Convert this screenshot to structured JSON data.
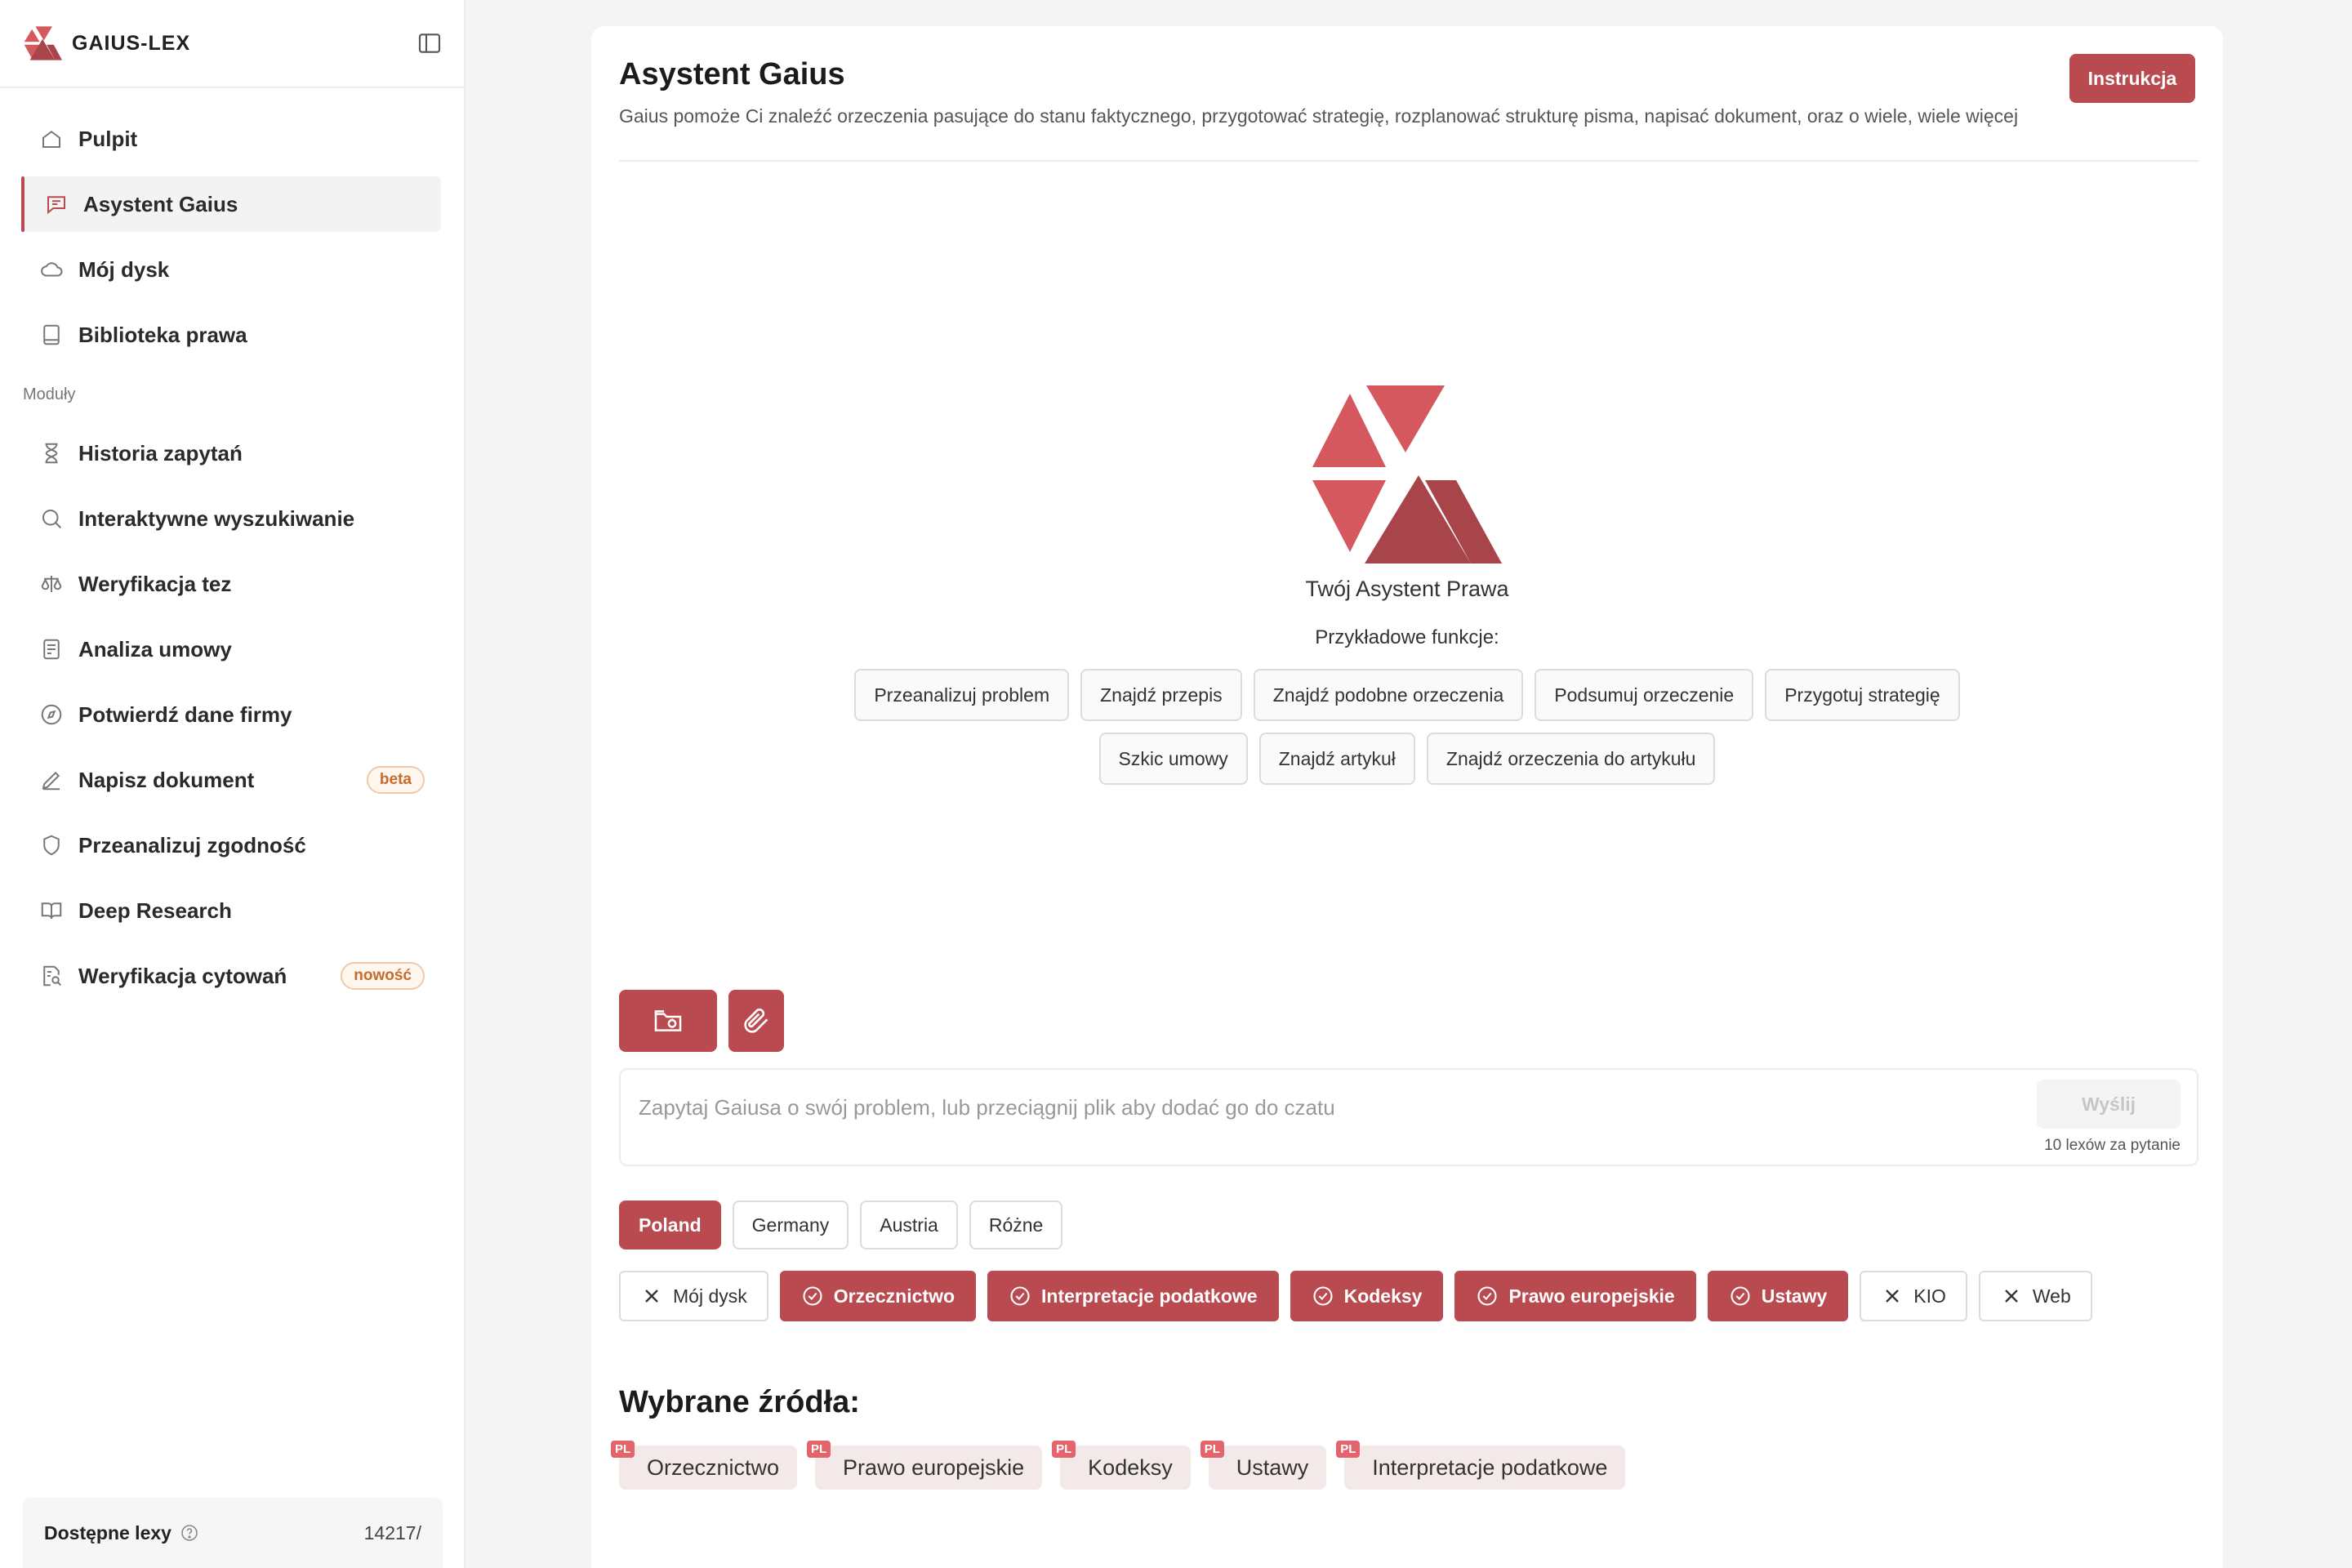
{
  "brand": {
    "name": "GAIUS-LEX"
  },
  "sidebar": {
    "items": [
      {
        "label": "Pulpit",
        "icon": "home-icon"
      },
      {
        "label": "Asystent Gaius",
        "icon": "chat-icon",
        "active": true
      },
      {
        "label": "Mój dysk",
        "icon": "cloud-icon"
      },
      {
        "label": "Biblioteka prawa",
        "icon": "book-icon"
      }
    ],
    "section_label": "Moduły",
    "modules": [
      {
        "label": "Historia zapytań",
        "icon": "hourglass-icon"
      },
      {
        "label": "Interaktywne wyszukiwanie",
        "icon": "search-icon"
      },
      {
        "label": "Weryfikacja tez",
        "icon": "scale-icon"
      },
      {
        "label": "Analiza umowy",
        "icon": "document-icon"
      },
      {
        "label": "Potwierdź dane firmy",
        "icon": "compass-icon"
      },
      {
        "label": "Napisz dokument",
        "icon": "pen-icon",
        "badge": "beta"
      },
      {
        "label": "Przeanalizuj zgodność",
        "icon": "shield-icon"
      },
      {
        "label": "Deep Research",
        "icon": "open-book-icon"
      },
      {
        "label": "Weryfikacja cytowań",
        "icon": "document-search-icon",
        "badge": "nowość"
      }
    ],
    "footer": {
      "label": "Dostępne lexy",
      "value": "14217/"
    }
  },
  "main": {
    "title": "Asystent Gaius",
    "subtitle": "Gaius pomoże Ci znaleźć orzeczenia pasujące do stanu faktycznego, przygotować strategię, rozplanować strukturę pisma, napisać dokument, oraz o wiele, wiele więcej",
    "instruction_button": "Instrukcja",
    "hero_title": "Twój Asystent Prawa",
    "examples_label": "Przykładowe funkcje:",
    "examples_row1": [
      "Przeanalizuj problem",
      "Znajdź przepis",
      "Znajdź podobne orzeczenia",
      "Podsumuj orzeczenie",
      "Przygotuj strategię"
    ],
    "examples_row2": [
      "Szkic umowy",
      "Znajdź artykuł",
      "Znajdź orzeczenia do artykułu"
    ],
    "input_placeholder": "Zapytaj Gaiusa o swój problem, lub przeciągnij plik aby dodać go do czatu",
    "send_button": "Wyślij",
    "cost_label": "10 lexów za pytanie",
    "countries": [
      "Poland",
      "Germany",
      "Austria",
      "Różne"
    ],
    "sources": [
      {
        "label": "Mój dysk",
        "on": false
      },
      {
        "label": "Orzecznictwo",
        "on": true
      },
      {
        "label": "Interpretacje podatkowe",
        "on": true
      },
      {
        "label": "Kodeksy",
        "on": true
      },
      {
        "label": "Prawo europejskie",
        "on": true
      },
      {
        "label": "Ustawy",
        "on": true
      },
      {
        "label": "KIO",
        "on": false
      },
      {
        "label": "Web",
        "on": false
      }
    ],
    "selected_title": "Wybrane źródła:",
    "selected_tag": "PL",
    "selected": [
      "Orzecznictwo",
      "Prawo europejskie",
      "Kodeksy",
      "Ustawy",
      "Interpretacje podatkowe"
    ]
  },
  "colors": {
    "accent": "#b94a50",
    "logo_light": "#d5585e",
    "logo_dark": "#a8454b",
    "badge_text": "#c56c2e"
  }
}
